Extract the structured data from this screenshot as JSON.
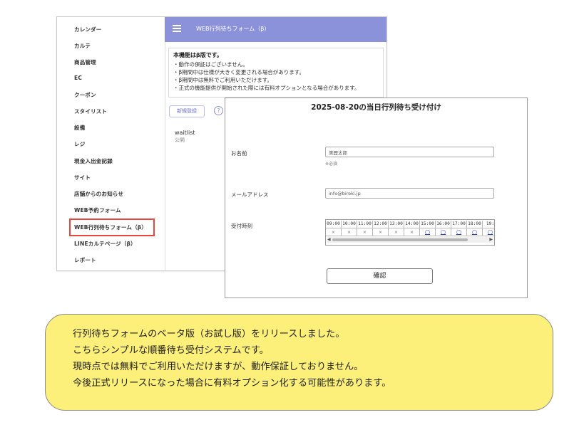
{
  "sidebar": {
    "items": [
      {
        "label": "カレンダー"
      },
      {
        "label": "カルテ"
      },
      {
        "label": "商品管理"
      },
      {
        "label": "EC"
      },
      {
        "label": "クーポン"
      },
      {
        "label": "スタイリスト"
      },
      {
        "label": "設備"
      },
      {
        "label": "レジ"
      },
      {
        "label": "現金入出金記録"
      },
      {
        "label": "サイト"
      },
      {
        "label": "店舗からのお知らせ"
      },
      {
        "label": "WEB予約フォーム"
      },
      {
        "label": "WEB行列待ちフォーム（β）"
      },
      {
        "label": "LINEカルテページ（β）"
      },
      {
        "label": "レポート"
      }
    ],
    "highlighted_index": 12,
    "highlight_color": "#e8453c"
  },
  "header": {
    "title": "WEB行列待ちフォーム（β）",
    "background": "#8c92d9",
    "menu_icon": "hamburger-icon"
  },
  "notice": {
    "title": "本機能はβ版です。",
    "lines": [
      "・動作の保証はございません。",
      "・β期間中は仕様が大きく変更される場合があります。",
      "・β期間中は無料でご利用いただけます。",
      "・正式の機能提供が開始された際には有料オプションとなる場合があります。"
    ]
  },
  "actions": {
    "new_button": "新規登録",
    "help_icon": "?"
  },
  "list": {
    "name": "waitlist",
    "status": "公開"
  },
  "form": {
    "title": "2025-08-20の当日行列待ち受け付け",
    "name_label": "お名前",
    "name_value": "美歴太郎",
    "required_note": "※必須",
    "email_label": "メールアドレス",
    "email_value": "info@bireki.jp",
    "time_label": "受付時刻",
    "time_slots": [
      "09:00",
      "10:00",
      "11:00",
      "12:00",
      "13:00",
      "14:00",
      "15:00",
      "16:00",
      "17:00",
      "18:00",
      "19:"
    ],
    "slot_status": [
      "×",
      "×",
      "×",
      "×",
      "×",
      "×",
      "◯",
      "◯",
      "◯",
      "◯",
      "◯"
    ],
    "confirm_button": "確認"
  },
  "announcement": {
    "lines": [
      "行列待ちフォームのベータ版（お試し版）をリリースしました。",
      "こちらシンプルな順番待ち受付システムです。",
      "現時点では無料でご利用いただけますが、動作保証しておりません。",
      "今後正式リリースになった場合に有料オプション化する可能性があります。"
    ],
    "background": "#fdf07a"
  }
}
